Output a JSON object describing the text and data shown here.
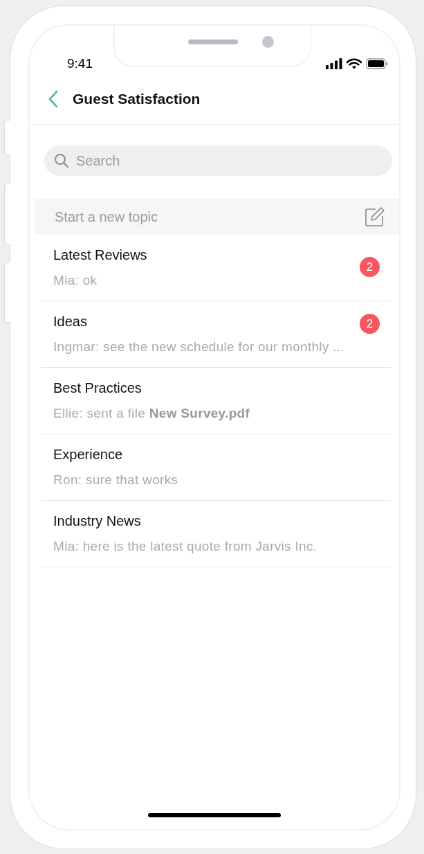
{
  "status_bar": {
    "time": "9:41"
  },
  "header": {
    "title": "Guest Satisfaction"
  },
  "search": {
    "placeholder": "Search"
  },
  "new_topic": {
    "placeholder": "Start a new topic"
  },
  "topics": [
    {
      "title": "Latest Reviews",
      "preview": "Mia: ok",
      "badge": "2"
    },
    {
      "title": "Ideas",
      "preview": "Ingmar: see the new schedule for our monthly ...",
      "badge": "2"
    },
    {
      "title": "Best Practices",
      "preview": "Ellie: sent a file **New Survey.pdf**"
    },
    {
      "title": "Experience",
      "preview": "Ron: sure that works"
    },
    {
      "title": "Industry News",
      "preview": "Mia: here is the latest quote from Jarvis Inc."
    }
  ]
}
